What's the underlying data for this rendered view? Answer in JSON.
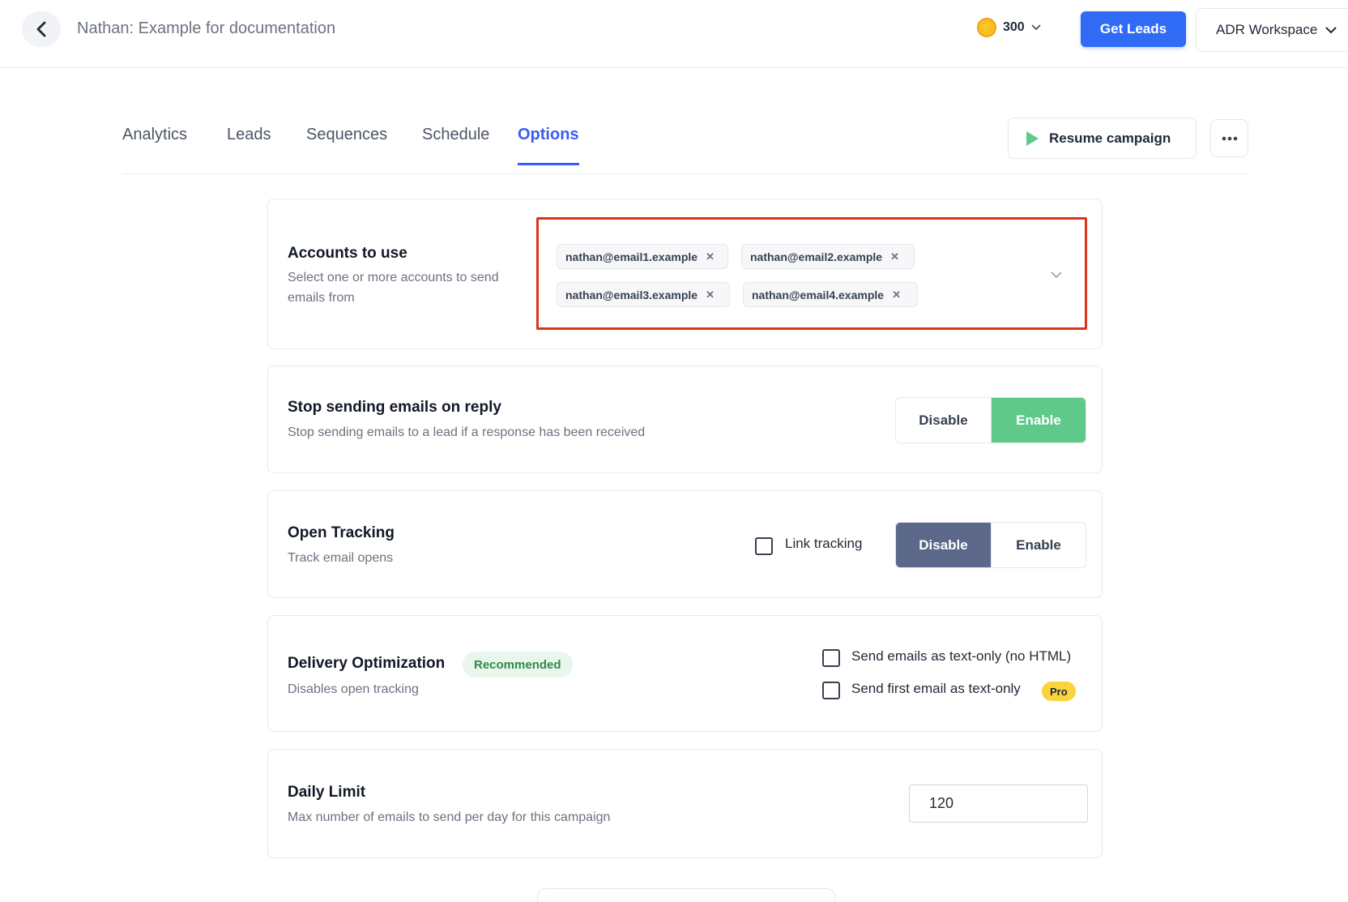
{
  "header": {
    "title": "Nathan: Example for documentation",
    "credits": "300",
    "get_leads_label": "Get Leads",
    "workspace": "ADR Workspace"
  },
  "tabs": [
    {
      "label": "Analytics",
      "active": false
    },
    {
      "label": "Leads",
      "active": false
    },
    {
      "label": "Sequences",
      "active": false
    },
    {
      "label": "Schedule",
      "active": false
    },
    {
      "label": "Options",
      "active": true
    }
  ],
  "actions": {
    "resume_label": "Resume campaign"
  },
  "accounts": {
    "title": "Accounts to use",
    "description": "Select one or more accounts to send emails from",
    "selected": [
      "nathan@email1.example",
      "nathan@email2.example",
      "nathan@email3.example",
      "nathan@email4.example"
    ]
  },
  "stop_on_reply": {
    "title": "Stop sending emails on reply",
    "description": "Stop sending emails to a lead if a response has been received",
    "disable_label": "Disable",
    "enable_label": "Enable",
    "value": "Enable"
  },
  "open_tracking": {
    "title": "Open Tracking",
    "description": "Track email opens",
    "link_tracking_label": "Link tracking",
    "link_tracking_checked": false,
    "disable_label": "Disable",
    "enable_label": "Enable",
    "value": "Disable"
  },
  "delivery": {
    "title": "Delivery Optimization",
    "badge": "Recommended",
    "description": "Disables open tracking",
    "text_only_label": "Send emails as text-only (no HTML)",
    "text_only_checked": false,
    "first_text_only_label": "Send first email as text-only",
    "first_text_only_checked": false,
    "pro_badge": "Pro"
  },
  "daily_limit": {
    "title": "Daily Limit",
    "description": "Max number of emails to send per day for this campaign",
    "value": "120"
  },
  "colors": {
    "primary": "#2f6bf5",
    "tab_active": "#3b5bf5",
    "enable_green": "#5fc98a",
    "disable_slate": "#5b6889",
    "highlight_red": "#d9361a"
  }
}
